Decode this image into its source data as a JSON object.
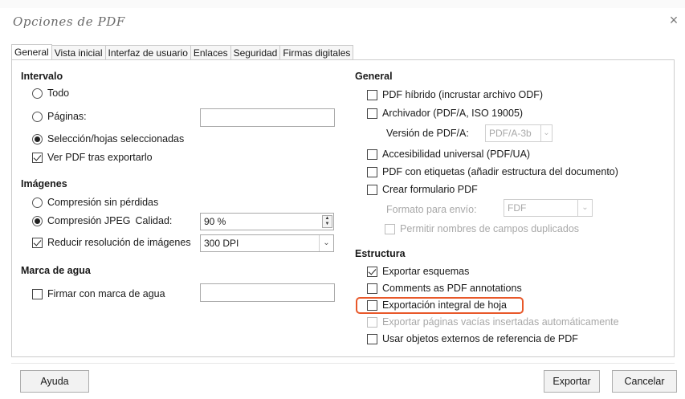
{
  "window": {
    "title": "Opciones de PDF",
    "close_glyph": "×"
  },
  "tabs": [
    "General",
    "Vista inicial",
    "Interfaz de usuario",
    "Enlaces",
    "Seguridad",
    "Firmas digitales"
  ],
  "left": {
    "intervalo": {
      "heading": "Intervalo",
      "todo": "Todo",
      "paginas": "Páginas:",
      "paginas_value": "",
      "seleccion": "Selección/hojas seleccionadas",
      "ver_pdf": "Ver PDF tras exportarlo"
    },
    "imagenes": {
      "heading": "Imágenes",
      "sin_perdidas": "Compresión sin pérdidas",
      "jpeg": "Compresión JPEG",
      "calidad": "Calidad:",
      "calidad_value": "90 %",
      "reducir": "Reducir resolución de imágenes",
      "dpi_value": "300 DPI"
    },
    "marca_agua": {
      "heading": "Marca de agua",
      "firmar": "Firmar con marca de agua",
      "watermark_value": ""
    }
  },
  "right": {
    "general": {
      "heading": "General",
      "hibrido": "PDF híbrido (incrustar archivo ODF)",
      "archivador": "Archivador (PDF/A, ISO 19005)",
      "version_label": "Versión de PDF/A:",
      "version_value": "PDF/A-3b",
      "accesibilidad": "Accesibilidad universal (PDF/UA)",
      "etiquetas": "PDF con etiquetas (añadir estructura del documento)",
      "formulario": "Crear formulario PDF",
      "formato_label": "Formato para envío:",
      "formato_value": "FDF",
      "permitir": "Permitir nombres de campos duplicados"
    },
    "estructura": {
      "heading": "Estructura",
      "esquemas": "Exportar esquemas",
      "comments": "Comments as PDF annotations",
      "integral": "Exportación integral de hoja",
      "vacias": "Exportar páginas vacías insertadas automáticamente",
      "externos": "Usar objetos externos de referencia de PDF"
    }
  },
  "buttons": {
    "ayuda": "Ayuda",
    "exportar": "Exportar",
    "cancelar": "Cancelar"
  },
  "colors": {
    "highlight": "#e8582a"
  }
}
